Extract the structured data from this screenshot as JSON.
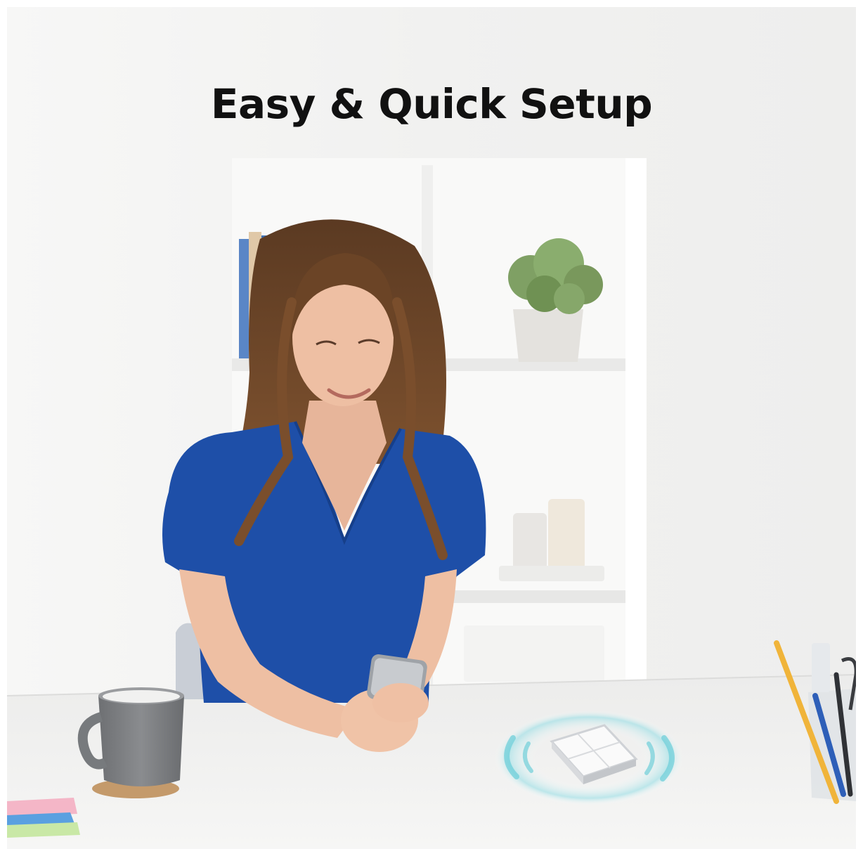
{
  "banner": {
    "headline": "Easy & Quick Setup"
  },
  "palette": {
    "wall": "#f4f4f3",
    "desk": "#f1f1f0",
    "blouse": "#1e4fa8",
    "hair": "#6b4426",
    "mug": "#7d7f82",
    "signal_ring": "#7fd6df"
  },
  "scene_objects": [
    "woman-with-smartphone",
    "white-bookshelf",
    "potted-plant",
    "grey-mug-on-coaster",
    "smart-switch-device",
    "pencil-holder",
    "sticky-notes"
  ]
}
